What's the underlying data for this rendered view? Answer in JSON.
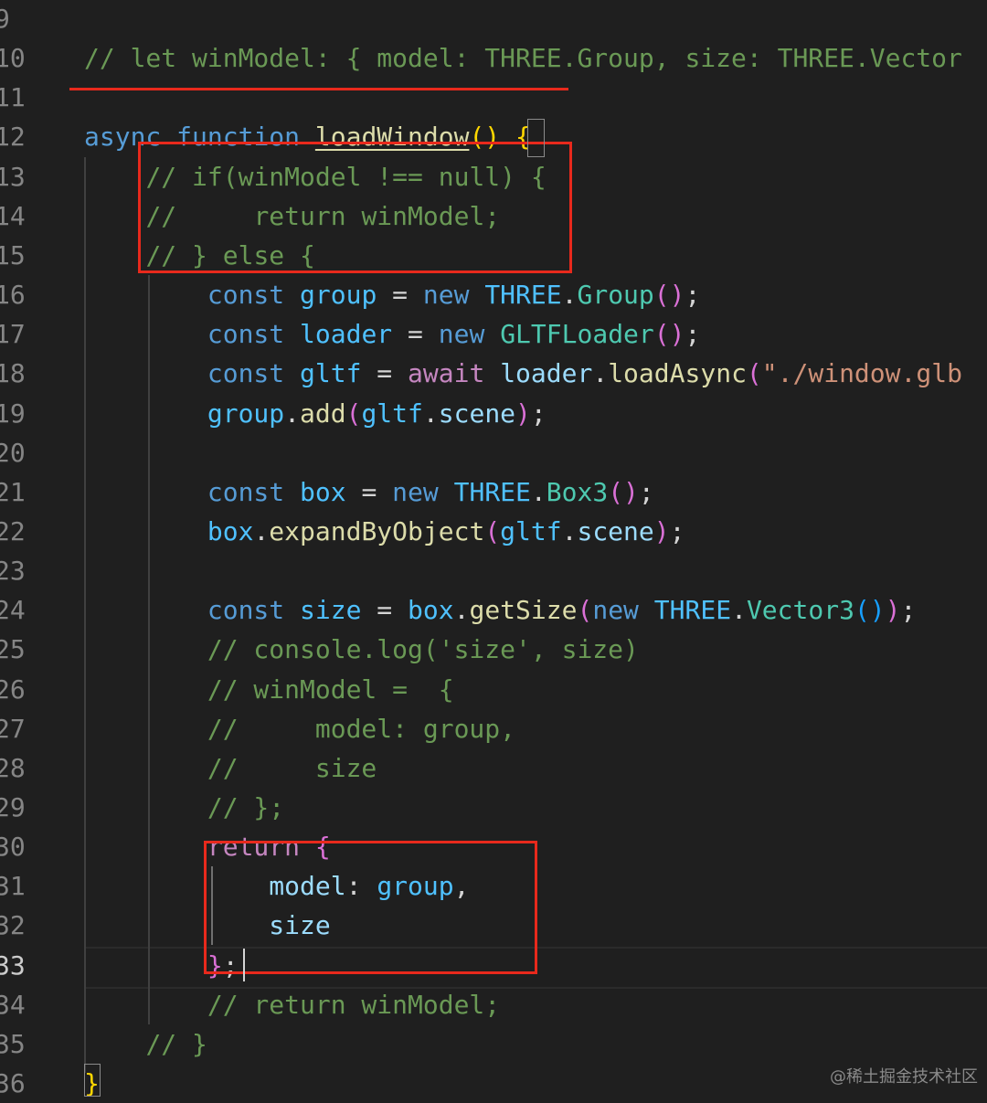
{
  "editor": {
    "lines": [
      {
        "num": "9",
        "tokens": []
      },
      {
        "num": "10",
        "tokens": [
          {
            "t": "// let winModel: { model: THREE.Group, size: THREE.Vector",
            "c": "c"
          }
        ]
      },
      {
        "num": "11",
        "tokens": []
      },
      {
        "num": "12",
        "tokens": [
          {
            "t": "async",
            "c": "k"
          },
          {
            "t": " ",
            "c": "p"
          },
          {
            "t": "function",
            "c": "k"
          },
          {
            "t": " ",
            "c": "p"
          },
          {
            "t": "loadWindow",
            "c": "fnu"
          },
          {
            "t": "()",
            "c": "b1"
          },
          {
            "t": " ",
            "c": "p"
          },
          {
            "t": "{",
            "c": "b1"
          }
        ]
      },
      {
        "num": "13",
        "tokens": [
          {
            "t": "    ",
            "c": "p"
          },
          {
            "t": "// if(winModel !== null) {",
            "c": "c"
          }
        ]
      },
      {
        "num": "14",
        "tokens": [
          {
            "t": "    ",
            "c": "p"
          },
          {
            "t": "//     return winModel;",
            "c": "c"
          }
        ]
      },
      {
        "num": "15",
        "tokens": [
          {
            "t": "    ",
            "c": "p"
          },
          {
            "t": "// } else {",
            "c": "c"
          }
        ]
      },
      {
        "num": "16",
        "tokens": [
          {
            "t": "        ",
            "c": "p"
          },
          {
            "t": "const",
            "c": "k"
          },
          {
            "t": " ",
            "c": "p"
          },
          {
            "t": "group",
            "c": "cn"
          },
          {
            "t": " = ",
            "c": "p"
          },
          {
            "t": "new",
            "c": "k"
          },
          {
            "t": " ",
            "c": "p"
          },
          {
            "t": "THREE",
            "c": "cn"
          },
          {
            "t": ".",
            "c": "p"
          },
          {
            "t": "Group",
            "c": "t"
          },
          {
            "t": "()",
            "c": "b2"
          },
          {
            "t": ";",
            "c": "p"
          }
        ]
      },
      {
        "num": "17",
        "tokens": [
          {
            "t": "        ",
            "c": "p"
          },
          {
            "t": "const",
            "c": "k"
          },
          {
            "t": " ",
            "c": "p"
          },
          {
            "t": "loader",
            "c": "cn"
          },
          {
            "t": " = ",
            "c": "p"
          },
          {
            "t": "new",
            "c": "k"
          },
          {
            "t": " ",
            "c": "p"
          },
          {
            "t": "GLTFLoader",
            "c": "t"
          },
          {
            "t": "()",
            "c": "b2"
          },
          {
            "t": ";",
            "c": "p"
          }
        ]
      },
      {
        "num": "18",
        "tokens": [
          {
            "t": "        ",
            "c": "p"
          },
          {
            "t": "const",
            "c": "k"
          },
          {
            "t": " ",
            "c": "p"
          },
          {
            "t": "gltf",
            "c": "cn"
          },
          {
            "t": " = ",
            "c": "p"
          },
          {
            "t": "await",
            "c": "ctl"
          },
          {
            "t": " ",
            "c": "p"
          },
          {
            "t": "loader",
            "c": "v"
          },
          {
            "t": ".",
            "c": "p"
          },
          {
            "t": "loadAsync",
            "c": "f"
          },
          {
            "t": "(",
            "c": "b2"
          },
          {
            "t": "\"./window.glb",
            "c": "s"
          }
        ]
      },
      {
        "num": "19",
        "tokens": [
          {
            "t": "        ",
            "c": "p"
          },
          {
            "t": "group",
            "c": "cn"
          },
          {
            "t": ".",
            "c": "p"
          },
          {
            "t": "add",
            "c": "f"
          },
          {
            "t": "(",
            "c": "b2"
          },
          {
            "t": "gltf",
            "c": "cn"
          },
          {
            "t": ".",
            "c": "p"
          },
          {
            "t": "scene",
            "c": "v"
          },
          {
            "t": ")",
            "c": "b2"
          },
          {
            "t": ";",
            "c": "p"
          }
        ]
      },
      {
        "num": "20",
        "tokens": []
      },
      {
        "num": "21",
        "tokens": [
          {
            "t": "        ",
            "c": "p"
          },
          {
            "t": "const",
            "c": "k"
          },
          {
            "t": " ",
            "c": "p"
          },
          {
            "t": "box",
            "c": "cn"
          },
          {
            "t": " = ",
            "c": "p"
          },
          {
            "t": "new",
            "c": "k"
          },
          {
            "t": " ",
            "c": "p"
          },
          {
            "t": "THREE",
            "c": "cn"
          },
          {
            "t": ".",
            "c": "p"
          },
          {
            "t": "Box3",
            "c": "t"
          },
          {
            "t": "()",
            "c": "b2"
          },
          {
            "t": ";",
            "c": "p"
          }
        ]
      },
      {
        "num": "22",
        "tokens": [
          {
            "t": "        ",
            "c": "p"
          },
          {
            "t": "box",
            "c": "cn"
          },
          {
            "t": ".",
            "c": "p"
          },
          {
            "t": "expandByObject",
            "c": "f"
          },
          {
            "t": "(",
            "c": "b2"
          },
          {
            "t": "gltf",
            "c": "cn"
          },
          {
            "t": ".",
            "c": "p"
          },
          {
            "t": "scene",
            "c": "v"
          },
          {
            "t": ")",
            "c": "b2"
          },
          {
            "t": ";",
            "c": "p"
          }
        ]
      },
      {
        "num": "23",
        "tokens": []
      },
      {
        "num": "24",
        "tokens": [
          {
            "t": "        ",
            "c": "p"
          },
          {
            "t": "const",
            "c": "k"
          },
          {
            "t": " ",
            "c": "p"
          },
          {
            "t": "size",
            "c": "cn"
          },
          {
            "t": " = ",
            "c": "p"
          },
          {
            "t": "box",
            "c": "cn"
          },
          {
            "t": ".",
            "c": "p"
          },
          {
            "t": "getSize",
            "c": "f"
          },
          {
            "t": "(",
            "c": "b2"
          },
          {
            "t": "new",
            "c": "k"
          },
          {
            "t": " ",
            "c": "p"
          },
          {
            "t": "THREE",
            "c": "cn"
          },
          {
            "t": ".",
            "c": "p"
          },
          {
            "t": "Vector3",
            "c": "t"
          },
          {
            "t": "()",
            "c": "b3"
          },
          {
            "t": ")",
            "c": "b2"
          },
          {
            "t": ";",
            "c": "p"
          }
        ]
      },
      {
        "num": "25",
        "tokens": [
          {
            "t": "        ",
            "c": "p"
          },
          {
            "t": "// console.log('size', size)",
            "c": "c"
          }
        ]
      },
      {
        "num": "26",
        "tokens": [
          {
            "t": "        ",
            "c": "p"
          },
          {
            "t": "// winModel =  {",
            "c": "c"
          }
        ]
      },
      {
        "num": "27",
        "tokens": [
          {
            "t": "        ",
            "c": "p"
          },
          {
            "t": "//     model: group,",
            "c": "c"
          }
        ]
      },
      {
        "num": "28",
        "tokens": [
          {
            "t": "        ",
            "c": "p"
          },
          {
            "t": "//     size",
            "c": "c"
          }
        ]
      },
      {
        "num": "29",
        "tokens": [
          {
            "t": "        ",
            "c": "p"
          },
          {
            "t": "// };",
            "c": "c"
          }
        ]
      },
      {
        "num": "30",
        "tokens": [
          {
            "t": "        ",
            "c": "p"
          },
          {
            "t": "return",
            "c": "ctl"
          },
          {
            "t": " ",
            "c": "p"
          },
          {
            "t": "{",
            "c": "b2"
          }
        ]
      },
      {
        "num": "31",
        "tokens": [
          {
            "t": "            ",
            "c": "p"
          },
          {
            "t": "model",
            "c": "v"
          },
          {
            "t": ": ",
            "c": "p"
          },
          {
            "t": "group",
            "c": "cn"
          },
          {
            "t": ",",
            "c": "p"
          }
        ]
      },
      {
        "num": "32",
        "tokens": [
          {
            "t": "            ",
            "c": "p"
          },
          {
            "t": "size",
            "c": "v"
          }
        ]
      },
      {
        "num": "33",
        "tokens": [
          {
            "t": "        ",
            "c": "p"
          },
          {
            "t": "}",
            "c": "b2"
          },
          {
            "t": ";",
            "c": "p"
          }
        ]
      },
      {
        "num": "34",
        "tokens": [
          {
            "t": "        ",
            "c": "p"
          },
          {
            "t": "// return winModel;",
            "c": "c"
          }
        ]
      },
      {
        "num": "35",
        "tokens": [
          {
            "t": "    ",
            "c": "p"
          },
          {
            "t": "// }",
            "c": "c"
          }
        ]
      },
      {
        "num": "36",
        "tokens": [
          {
            "t": "}",
            "c": "b1"
          }
        ]
      }
    ],
    "active_line": "33"
  },
  "watermark": "@稀土掘金技术社区",
  "colors": {
    "background": "#1f1f1f",
    "comment": "#6a9955",
    "keyword": "#569cd6",
    "annotation_red": "#e8291c"
  }
}
